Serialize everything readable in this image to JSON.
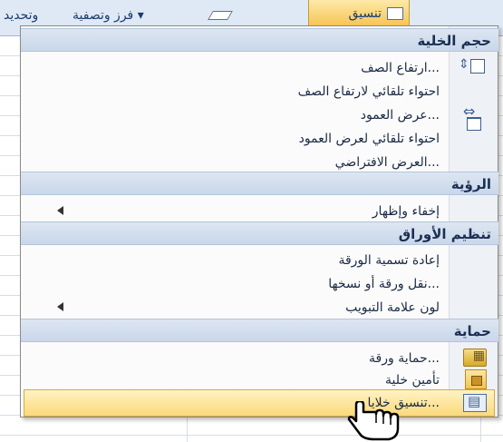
{
  "ribbon": {
    "format_label": "تنسيق",
    "sort_filter_label": "فرز وتصفية ▾",
    "find_label": "وتحديد"
  },
  "menu": {
    "sections": {
      "cell_size": "حجم الخلية",
      "visibility": "الرؤية",
      "organize_sheets": "تنظيم الأوراق",
      "protection": "حماية"
    },
    "items": {
      "row_height": "ارتفاع الصف...",
      "autofit_row": "احتواء تلقائي لارتفاع الصف",
      "column_width": "عرض العمود...",
      "autofit_column": "احتواء تلقائي لعرض العمود",
      "default_width": "العرض الافتراضي...",
      "hide_unhide": "إخفاء وإظهار",
      "rename_sheet": "إعادة تسمية الورقة",
      "move_copy": "نقل ورقة أو نسخها...",
      "tab_color": "لون علامة التبويب",
      "protect_sheet": "حماية ورقة...",
      "lock_cell": "تأمين خلية",
      "format_cells": "تنسيق خلايا..."
    }
  },
  "icons": {
    "row_height": "row-height-icon",
    "column_width": "column-width-icon",
    "protect_sheet": "protect-sheet-icon",
    "lock_cell": "lock-icon",
    "format_cells": "format-cells-icon",
    "cursor": "hand-cursor-icon"
  },
  "colors": {
    "header_bg": "#c9d7ea",
    "hover_bg": "#fbd97a",
    "text": "#1a2a44"
  }
}
